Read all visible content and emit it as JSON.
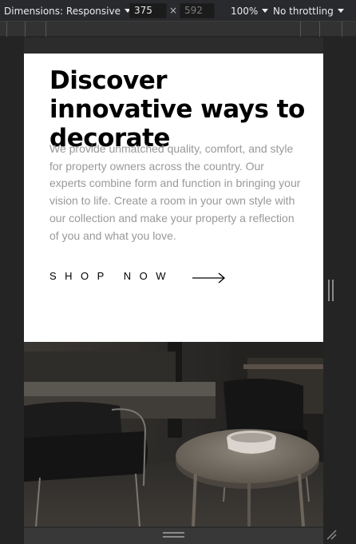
{
  "devtools": {
    "dimensions_label": "Dimensions: Responsive",
    "width_value": "375",
    "times": "×",
    "height_value": "592",
    "zoom_label": "100%",
    "throttling_label": "No throttling"
  },
  "hero": {
    "headline": "Discover innovative ways to decorate",
    "body": "We provide unmatched quality, comfort, and style for property owners across the country. Our experts combine form and function in bringing your vision to life. Create a room in your own style with our collection and make your property a reflection of you and what you love.",
    "cta_label": "SHOP NOW"
  },
  "icons": {
    "cta_arrow": "arrow-right-icon",
    "side_handle": "resize-handle-icon",
    "bottom_handle": "resize-handle-icon",
    "corner": "resize-corner-icon"
  },
  "colors": {
    "toolbar_bg": "#292a2d",
    "body_text": "#999999",
    "headline": "#000000"
  }
}
